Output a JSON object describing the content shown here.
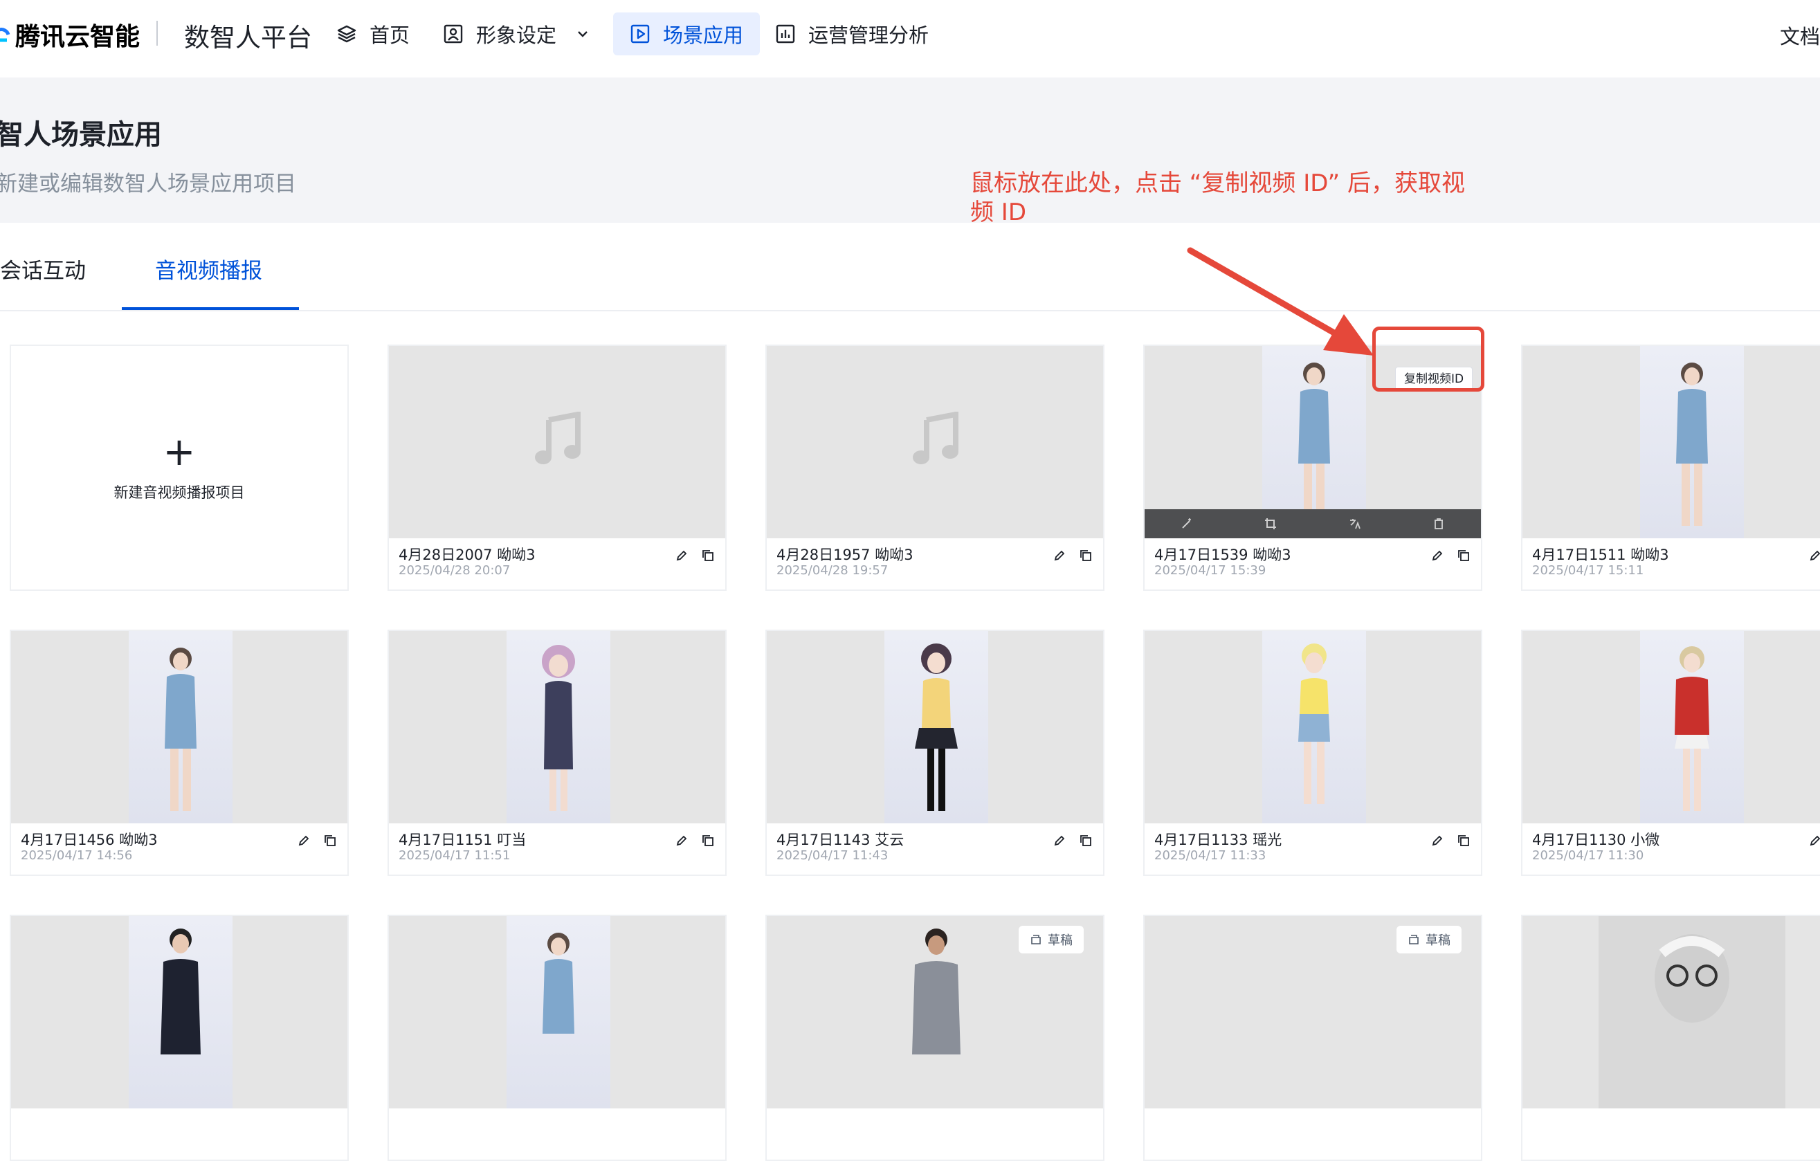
{
  "nav": {
    "brand": "腾讯云智能",
    "platform": "数智人平台",
    "items": [
      {
        "label": "首页"
      },
      {
        "label": "形象设定"
      },
      {
        "label": "场景应用"
      },
      {
        "label": "运营管理分析"
      }
    ],
    "docs": "文档"
  },
  "header": {
    "title": "智人场景应用",
    "subtitle": "新建或编辑数智人场景应用项目"
  },
  "annotation": "鼠标放在此处，点击 “复制视频 ID” 后，获取视频 ID",
  "tabs": [
    {
      "label": "会话互动"
    },
    {
      "label": "音视频播报"
    }
  ],
  "new_project_label": "新建音视频播报项目",
  "copy_video_id_label": "复制视频ID",
  "draft_label": "草稿",
  "colors": {
    "accent": "#0052d9",
    "annotation": "#e5483a"
  },
  "cards": [
    {
      "title": "4月28日2007 呦呦3",
      "date": "2025/04/28 20:07"
    },
    {
      "title": "4月28日1957 呦呦3",
      "date": "2025/04/28 19:57"
    },
    {
      "title": "4月17日1539 呦呦3",
      "date": "2025/04/17 15:39"
    },
    {
      "title": "4月17日1511 呦呦3",
      "date": "2025/04/17 15:11"
    },
    {
      "title": "4月17日1456 呦呦3",
      "date": "2025/04/17 14:56"
    },
    {
      "title": "4月17日1151 叮当",
      "date": "2025/04/17 11:51"
    },
    {
      "title": "4月17日1143 艾云",
      "date": "2025/04/17 11:43"
    },
    {
      "title": "4月17日1133 瑶光",
      "date": "2025/04/17 11:33"
    },
    {
      "title": "4月17日1130 小微",
      "date": "2025/04/17 11:30"
    }
  ]
}
